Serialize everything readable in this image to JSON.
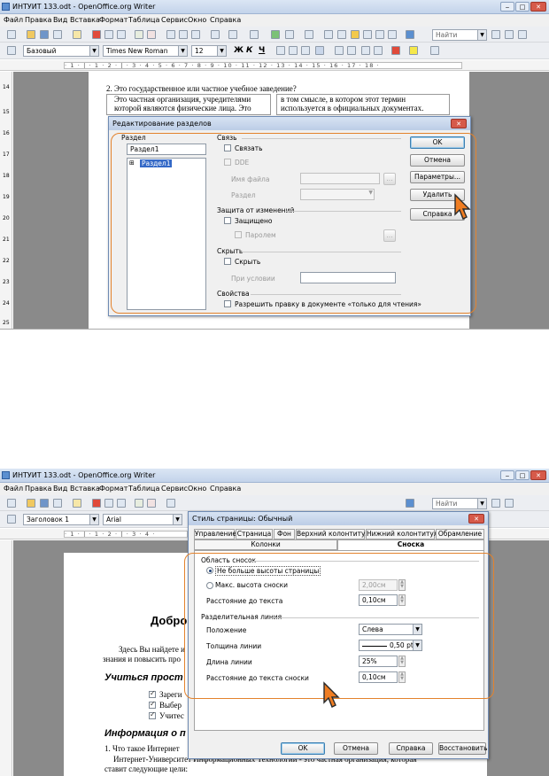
{
  "top": {
    "window_title": "ИНТУИТ 133.odt - OpenOffice.org Writer",
    "menu": [
      "Файл",
      "Правка",
      "Вид",
      "Вставка",
      "Формат",
      "Таблица",
      "Сервис",
      "Окно",
      "Справка"
    ],
    "find_placeholder": "Найти",
    "style_value": "Базовый",
    "font_value": "Times New Roman",
    "size_value": "12",
    "ruler_text": "· 1 · | · 1 · 2 · | · 3 · 4 · 5 · 6 · 7 · 8 · 9 · 10 · 11 · 12 · 13 · 14 · 15 · 16 · 17 · 18 ·",
    "vruler_numbers": [
      "14",
      "15",
      "16",
      "17",
      "18",
      "19",
      "20",
      "21",
      "22",
      "23",
      "24",
      "25"
    ],
    "doc_lines": {
      "heading": "2.  Это государственное или частное учебное заведение?",
      "col1_l1": "Это  частная  организация,  учредителями",
      "col1_l2": "которой   являются   физические   лица.   Это",
      "col2_l1": "в  том  смысле,  в  котором  этот  термин",
      "col2_l2": "используется в официальных документах."
    },
    "dialog": {
      "title": "Редактирование разделов",
      "section_label": "Раздел",
      "section_name_value": "Раздел1",
      "tree_item": "Раздел1",
      "link_group": "Связь",
      "link_check": "Связать",
      "dde_check": "DDE",
      "filename_label": "Имя файла",
      "section_field_label": "Раздел",
      "browse_button": "...",
      "protect_group": "Защита от изменений",
      "protected_check": "Защищено",
      "password_check": "Паролем",
      "password_button": "...",
      "hide_group": "Скрыть",
      "hide_check": "Скрыть",
      "condition_label": "При условии",
      "props_group": "Свойства",
      "allow_edit_check": "Разрешить правку в документе «только для чтения»",
      "ok_button": "OK",
      "cancel_button": "Отмена",
      "options_button": "Параметры...",
      "delete_button": "Удалить",
      "help_button": "Справка"
    }
  },
  "bottom": {
    "window_title": "ИНТУИТ 133.odt - OpenOffice.org Writer",
    "menu": [
      "Файл",
      "Правка",
      "Вид",
      "Вставка",
      "Формат",
      "Таблица",
      "Сервис",
      "Окно",
      "Справка"
    ],
    "find_placeholder": "Найти",
    "style_value": "Заголовок 1",
    "font_value": "Arial",
    "ruler_text": "· 1 · | · 1 · 2 · | · 3 · 4 ·",
    "doc_lines": {
      "heading_partial": "Добро",
      "p1": "Здесь  Вы  найдете  и",
      "p2": "знания и повысить про",
      "h2": "Учиться прост",
      "item1": "Зареги",
      "item2": "Выбер",
      "item3": "Учитес",
      "h3": "Информация о п",
      "q1": "1.  Что такое Интернет",
      "p3": "Интернет-Университет Информационных Технологий - это частная организация, которая",
      "p4": "ставит следующие цели:"
    },
    "dialog": {
      "title": "Стиль страницы: Обычный",
      "tabs_row1": [
        "Управление",
        "Страница",
        "Фон",
        "Верхний колонтитул",
        "Нижний колонтитул",
        "Обрамление"
      ],
      "tabs_row2": [
        "Колонки",
        "Сноска"
      ],
      "area_group": "Область сносок",
      "radio_no_more": "Не больше высоты страницы",
      "radio_max": "Макс. высота сноски",
      "max_value": "2,00см",
      "distance_label": "Расстояние до текста",
      "distance_value": "0,10см",
      "line_group": "Разделительная линия",
      "position_label": "Положение",
      "position_value": "Слева",
      "thickness_label": "Толщина линии",
      "thickness_value": "0,50 pt",
      "length_label": "Длина линии",
      "length_value": "25%",
      "note_distance_label": "Расстояние до текста сноски",
      "note_distance_value": "0,10см",
      "ok_button": "OK",
      "cancel_button": "Отмена",
      "help_button": "Справка",
      "restore_button": "Восстановить"
    }
  }
}
